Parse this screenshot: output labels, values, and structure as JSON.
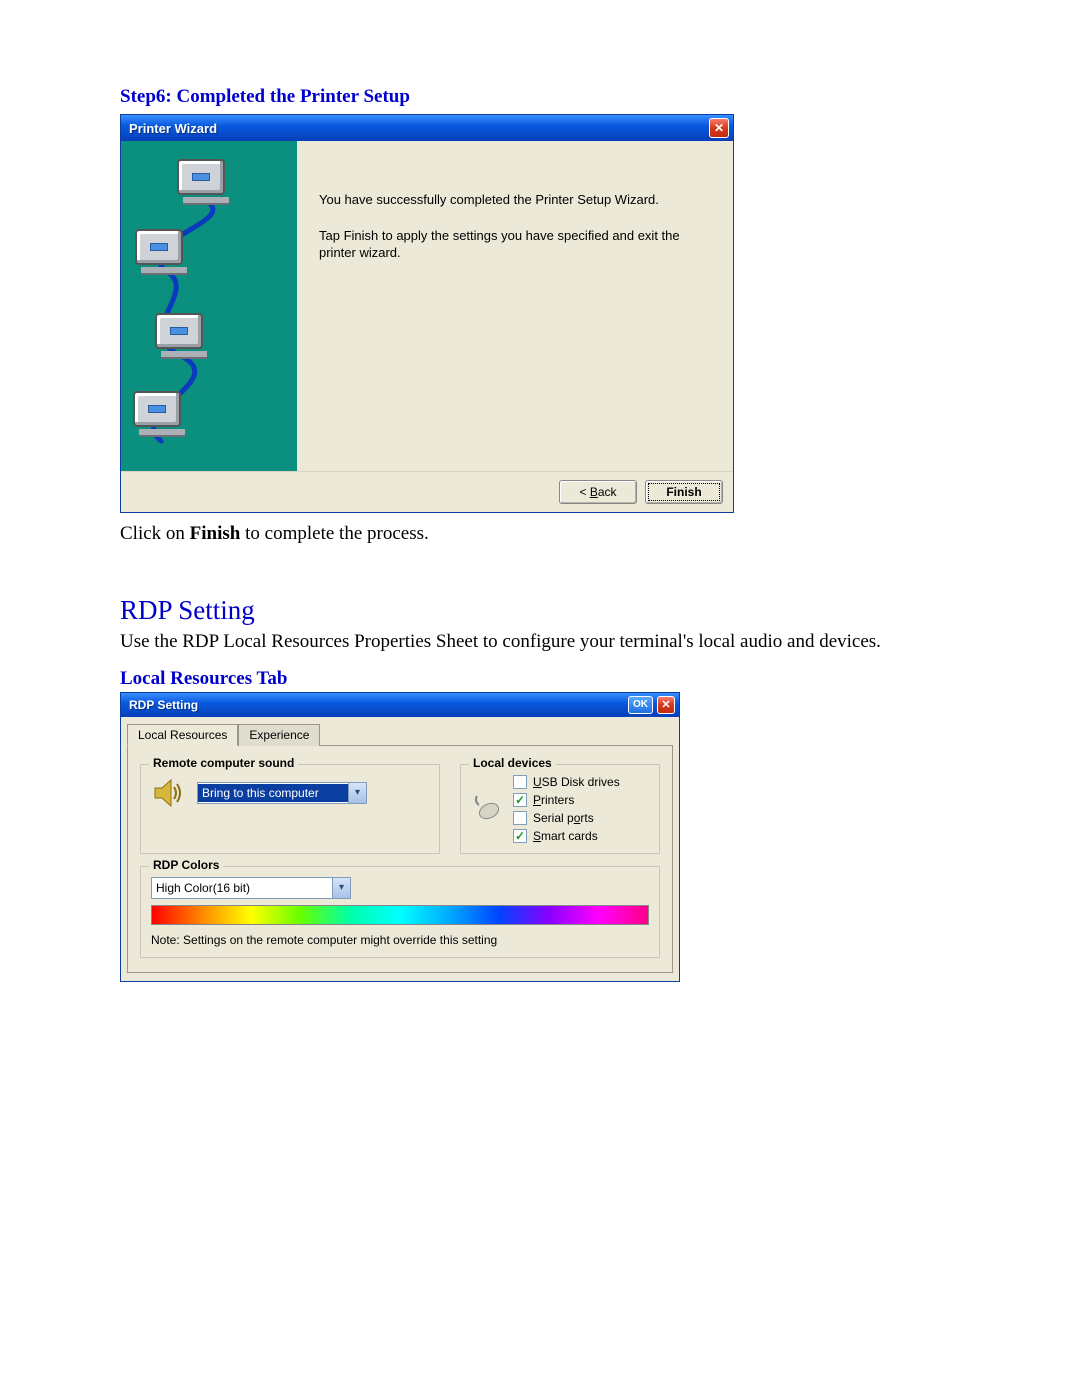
{
  "step6": {
    "heading": "Step6: Completed the Printer Setup",
    "instruction_prefix": "Click on ",
    "instruction_bold": "Finish",
    "instruction_suffix": " to complete the process."
  },
  "printer_wizard": {
    "title": "Printer Wizard",
    "msg1": "You have successfully completed the Printer Setup Wizard.",
    "msg2": "Tap Finish to apply the settings you have specified and exit the printer wizard.",
    "back_prefix": "< ",
    "back_u": "B",
    "back_suffix": "ack",
    "finish": "Finish"
  },
  "rdp": {
    "section_heading": "RDP Setting",
    "body": "Use the RDP Local Resources Properties Sheet to configure your terminal's local audio and devices.",
    "sub_heading": "Local Resources Tab"
  },
  "rdp_window": {
    "title": "RDP Setting",
    "ok": "OK",
    "tabs": {
      "local": "Local Resources",
      "experience": "Experience"
    },
    "sound_legend": "Remote computer sound",
    "sound_value": "Bring to this computer",
    "devices_legend": "Local devices",
    "devices": [
      {
        "label_pre": "",
        "label_u": "U",
        "label_post": "SB Disk drives",
        "checked": false
      },
      {
        "label_pre": "",
        "label_u": "P",
        "label_post": "rinters",
        "checked": true
      },
      {
        "label_pre": "Serial p",
        "label_u": "o",
        "label_post": "rts",
        "checked": false
      },
      {
        "label_pre": "",
        "label_u": "S",
        "label_post": "mart cards",
        "checked": true
      }
    ],
    "colors_legend": "RDP Colors",
    "colors_value": "High Color(16 bit)",
    "note": "Note: Settings on the remote computer might  override this setting"
  }
}
